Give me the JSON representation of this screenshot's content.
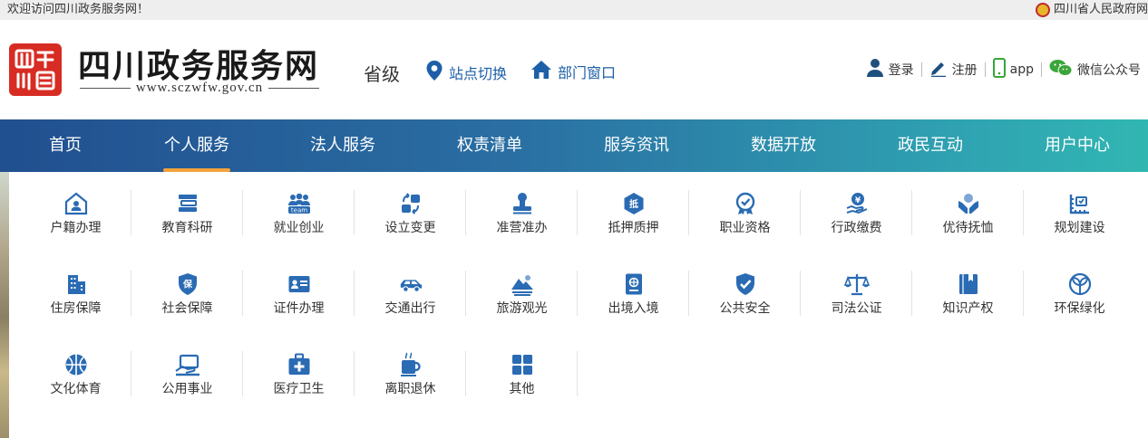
{
  "topbar": {
    "welcome": "欢迎访问四川政务服务网！",
    "gov_link": "四川省人民政府网"
  },
  "header": {
    "site_title": "四川政务服务网",
    "site_url": "www.sczwfw.gov.cn",
    "level": "省级",
    "station_switch": "站点切换",
    "dept_window": "部门窗口",
    "login": "登录",
    "register": "注册",
    "app": "app",
    "wechat": "微信公众号"
  },
  "nav": {
    "tabs": [
      {
        "label": "首页"
      },
      {
        "label": "个人服务"
      },
      {
        "label": "法人服务"
      },
      {
        "label": "权责清单"
      },
      {
        "label": "服务资讯"
      },
      {
        "label": "数据开放"
      },
      {
        "label": "政民互动"
      },
      {
        "label": "用户中心"
      }
    ],
    "active_index": 1
  },
  "services": [
    {
      "label": "户籍办理",
      "icon": "household-icon"
    },
    {
      "label": "教育科研",
      "icon": "education-icon"
    },
    {
      "label": "就业创业",
      "icon": "team-icon"
    },
    {
      "label": "设立变更",
      "icon": "change-icon"
    },
    {
      "label": "准营准办",
      "icon": "stamp-icon"
    },
    {
      "label": "抵押质押",
      "icon": "mortgage-icon"
    },
    {
      "label": "职业资格",
      "icon": "certificate-icon"
    },
    {
      "label": "行政缴费",
      "icon": "fee-icon"
    },
    {
      "label": "优待抚恤",
      "icon": "care-icon"
    },
    {
      "label": "规划建设",
      "icon": "ruler-icon"
    },
    {
      "label": "住房保障",
      "icon": "building-icon"
    },
    {
      "label": "社会保障",
      "icon": "shield-bao-icon"
    },
    {
      "label": "证件办理",
      "icon": "id-card-icon"
    },
    {
      "label": "交通出行",
      "icon": "car-icon"
    },
    {
      "label": "旅游观光",
      "icon": "mountain-icon"
    },
    {
      "label": "出境入境",
      "icon": "passport-icon"
    },
    {
      "label": "公共安全",
      "icon": "shield-check-icon"
    },
    {
      "label": "司法公证",
      "icon": "scales-icon"
    },
    {
      "label": "知识产权",
      "icon": "book-icon"
    },
    {
      "label": "环保绿化",
      "icon": "leaf-icon"
    },
    {
      "label": "文化体育",
      "icon": "ball-icon"
    },
    {
      "label": "公用事业",
      "icon": "laptop-icon"
    },
    {
      "label": "医疗卫生",
      "icon": "medical-icon"
    },
    {
      "label": "离职退休",
      "icon": "cup-icon"
    },
    {
      "label": "其他",
      "icon": "grid-icon"
    }
  ],
  "colors": {
    "brand_red": "#d72c23",
    "link_blue": "#1d5fa8",
    "icon_blue": "#2a6bb3",
    "nav_active_underline": "#f4a23b"
  }
}
